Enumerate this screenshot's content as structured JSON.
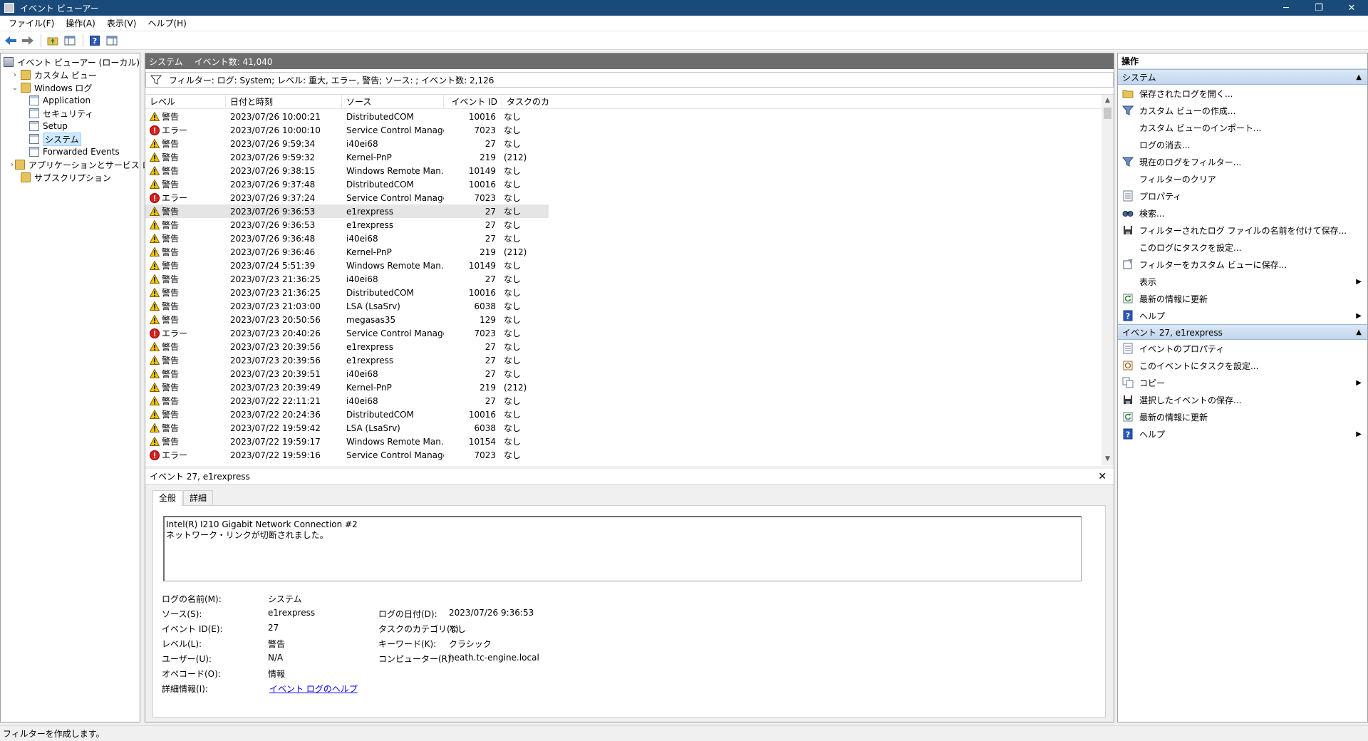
{
  "window": {
    "title": "イベント ビューアー",
    "min": "─",
    "max": "❐",
    "close": "✕"
  },
  "menu": [
    "ファイル(F)",
    "操作(A)",
    "表示(V)",
    "ヘルプ(H)"
  ],
  "tree": [
    {
      "label": "イベント ビューアー (ローカル)",
      "indent": 0,
      "exp": "",
      "icon": "viewer"
    },
    {
      "label": "カスタム ビュー",
      "indent": 1,
      "exp": "›",
      "icon": "folder"
    },
    {
      "label": "Windows ログ",
      "indent": 1,
      "exp": "⌄",
      "icon": "folder"
    },
    {
      "label": "Application",
      "indent": 2,
      "exp": "",
      "icon": "log"
    },
    {
      "label": "セキュリティ",
      "indent": 2,
      "exp": "",
      "icon": "log"
    },
    {
      "label": "Setup",
      "indent": 2,
      "exp": "",
      "icon": "log"
    },
    {
      "label": "システム",
      "indent": 2,
      "exp": "",
      "icon": "log",
      "selected": true
    },
    {
      "label": "Forwarded Events",
      "indent": 2,
      "exp": "",
      "icon": "log"
    },
    {
      "label": "アプリケーションとサービス ログ",
      "indent": 1,
      "exp": "›",
      "icon": "folder"
    },
    {
      "label": "サブスクリプション",
      "indent": 1,
      "exp": "",
      "icon": "folder"
    }
  ],
  "center": {
    "log_name": "システム",
    "event_count": "イベント数: 41,040",
    "filter_text": "フィルター: ログ: System; レベル: 重大, エラー, 警告; ソース: ; イベント数: 2,126"
  },
  "columns": [
    "レベル",
    "日付と時刻",
    "ソース",
    "イベント ID",
    "タスクのカ..."
  ],
  "events": [
    {
      "type": "warning",
      "level": "警告",
      "date": "2023/07/26 10:00:21",
      "source": "DistributedCOM",
      "id": "10016",
      "task": "なし"
    },
    {
      "type": "error",
      "level": "エラー",
      "date": "2023/07/26 10:00:10",
      "source": "Service Control Manager",
      "id": "7023",
      "task": "なし"
    },
    {
      "type": "warning",
      "level": "警告",
      "date": "2023/07/26 9:59:34",
      "source": "i40ei68",
      "id": "27",
      "task": "なし"
    },
    {
      "type": "warning",
      "level": "警告",
      "date": "2023/07/26 9:59:32",
      "source": "Kernel-PnP",
      "id": "219",
      "task": "(212)"
    },
    {
      "type": "warning",
      "level": "警告",
      "date": "2023/07/26 9:38:15",
      "source": "Windows Remote Man...",
      "id": "10149",
      "task": "なし"
    },
    {
      "type": "warning",
      "level": "警告",
      "date": "2023/07/26 9:37:48",
      "source": "DistributedCOM",
      "id": "10016",
      "task": "なし"
    },
    {
      "type": "error",
      "level": "エラー",
      "date": "2023/07/26 9:37:24",
      "source": "Service Control Manager",
      "id": "7023",
      "task": "なし"
    },
    {
      "type": "warning",
      "level": "警告",
      "date": "2023/07/26 9:36:53",
      "source": "e1rexpress",
      "id": "27",
      "task": "なし",
      "selected": true
    },
    {
      "type": "warning",
      "level": "警告",
      "date": "2023/07/26 9:36:53",
      "source": "e1rexpress",
      "id": "27",
      "task": "なし"
    },
    {
      "type": "warning",
      "level": "警告",
      "date": "2023/07/26 9:36:48",
      "source": "i40ei68",
      "id": "27",
      "task": "なし"
    },
    {
      "type": "warning",
      "level": "警告",
      "date": "2023/07/26 9:36:46",
      "source": "Kernel-PnP",
      "id": "219",
      "task": "(212)"
    },
    {
      "type": "warning",
      "level": "警告",
      "date": "2023/07/24 5:51:39",
      "source": "Windows Remote Man...",
      "id": "10149",
      "task": "なし"
    },
    {
      "type": "warning",
      "level": "警告",
      "date": "2023/07/23 21:36:25",
      "source": "i40ei68",
      "id": "27",
      "task": "なし"
    },
    {
      "type": "warning",
      "level": "警告",
      "date": "2023/07/23 21:36:25",
      "source": "DistributedCOM",
      "id": "10016",
      "task": "なし"
    },
    {
      "type": "warning",
      "level": "警告",
      "date": "2023/07/23 21:03:00",
      "source": "LSA (LsaSrv)",
      "id": "6038",
      "task": "なし"
    },
    {
      "type": "warning",
      "level": "警告",
      "date": "2023/07/23 20:50:56",
      "source": "megasas35",
      "id": "129",
      "task": "なし"
    },
    {
      "type": "error",
      "level": "エラー",
      "date": "2023/07/23 20:40:26",
      "source": "Service Control Manager",
      "id": "7023",
      "task": "なし"
    },
    {
      "type": "warning",
      "level": "警告",
      "date": "2023/07/23 20:39:56",
      "source": "e1rexpress",
      "id": "27",
      "task": "なし"
    },
    {
      "type": "warning",
      "level": "警告",
      "date": "2023/07/23 20:39:56",
      "source": "e1rexpress",
      "id": "27",
      "task": "なし"
    },
    {
      "type": "warning",
      "level": "警告",
      "date": "2023/07/23 20:39:51",
      "source": "i40ei68",
      "id": "27",
      "task": "なし"
    },
    {
      "type": "warning",
      "level": "警告",
      "date": "2023/07/23 20:39:49",
      "source": "Kernel-PnP",
      "id": "219",
      "task": "(212)"
    },
    {
      "type": "warning",
      "level": "警告",
      "date": "2023/07/22 22:11:21",
      "source": "i40ei68",
      "id": "27",
      "task": "なし"
    },
    {
      "type": "warning",
      "level": "警告",
      "date": "2023/07/22 20:24:36",
      "source": "DistributedCOM",
      "id": "10016",
      "task": "なし"
    },
    {
      "type": "warning",
      "level": "警告",
      "date": "2023/07/22 19:59:42",
      "source": "LSA (LsaSrv)",
      "id": "6038",
      "task": "なし"
    },
    {
      "type": "warning",
      "level": "警告",
      "date": "2023/07/22 19:59:17",
      "source": "Windows Remote Man...",
      "id": "10154",
      "task": "なし"
    },
    {
      "type": "error",
      "level": "エラー",
      "date": "2023/07/22 19:59:16",
      "source": "Service Control Manager",
      "id": "7023",
      "task": "なし"
    }
  ],
  "details": {
    "title": "イベント 27, e1rexpress",
    "close": "✕",
    "tabs": [
      "全般",
      "詳細"
    ],
    "description": "Intel(R) I210 Gigabit Network Connection #2\nネットワーク・リンクが切断されました。",
    "props": {
      "log_name_label": "ログの名前(M):",
      "log_name": "システム",
      "source_label": "ソース(S):",
      "source": "e1rexpress",
      "logged_label": "ログの日付(D):",
      "logged": "2023/07/26 9:36:53",
      "event_id_label": "イベント ID(E):",
      "event_id": "27",
      "task_label": "タスクのカテゴリ(Y):",
      "task": "なし",
      "level_label": "レベル(L):",
      "level": "警告",
      "keywords_label": "キーワード(K):",
      "keywords": "クラシック",
      "user_label": "ユーザー(U):",
      "user": "N/A",
      "computer_label": "コンピューター(R):",
      "computer": "heath.tc-engine.local",
      "opcode_label": "オペコード(O):",
      "opcode": "情報",
      "more_label": "詳細情報(I):",
      "more_link": "イベント ログのヘルプ"
    }
  },
  "actions": {
    "title": "操作",
    "sections": [
      {
        "title": "システム",
        "items": [
          {
            "label": "保存されたログを開く...",
            "icon": "open",
            "arrow": false
          },
          {
            "label": "カスタム ビューの作成...",
            "icon": "filter",
            "arrow": false
          },
          {
            "label": "カスタム ビューのインポート...",
            "icon": "none",
            "arrow": false
          },
          {
            "label": "ログの消去...",
            "icon": "none",
            "arrow": false
          },
          {
            "label": "現在のログをフィルター...",
            "icon": "filter",
            "arrow": false
          },
          {
            "label": "フィルターのクリア",
            "icon": "none",
            "arrow": false
          },
          {
            "label": "プロパティ",
            "icon": "props",
            "arrow": false
          },
          {
            "label": "検索...",
            "icon": "find",
            "arrow": false
          },
          {
            "label": "フィルターされたログ ファイルの名前を付けて保存...",
            "icon": "save",
            "arrow": false
          },
          {
            "label": "このログにタスクを設定...",
            "icon": "none",
            "arrow": false
          },
          {
            "label": "フィルターをカスタム ビューに保存...",
            "icon": "saveview",
            "arrow": false
          },
          {
            "label": "表示",
            "icon": "none",
            "arrow": true
          },
          {
            "label": "最新の情報に更新",
            "icon": "refresh",
            "arrow": false
          },
          {
            "label": "ヘルプ",
            "icon": "help",
            "arrow": true
          }
        ]
      },
      {
        "title": "イベント 27, e1rexpress",
        "items": [
          {
            "label": "イベントのプロパティ",
            "icon": "props",
            "arrow": false
          },
          {
            "label": "このイベントにタスクを設定...",
            "icon": "task",
            "arrow": false
          },
          {
            "label": "コピー",
            "icon": "copy",
            "arrow": true
          },
          {
            "label": "選択したイベントの保存...",
            "icon": "save",
            "arrow": false
          },
          {
            "label": "最新の情報に更新",
            "icon": "refresh",
            "arrow": false
          },
          {
            "label": "ヘルプ",
            "icon": "help",
            "arrow": true
          }
        ]
      }
    ]
  },
  "status": "フィルターを作成します。"
}
